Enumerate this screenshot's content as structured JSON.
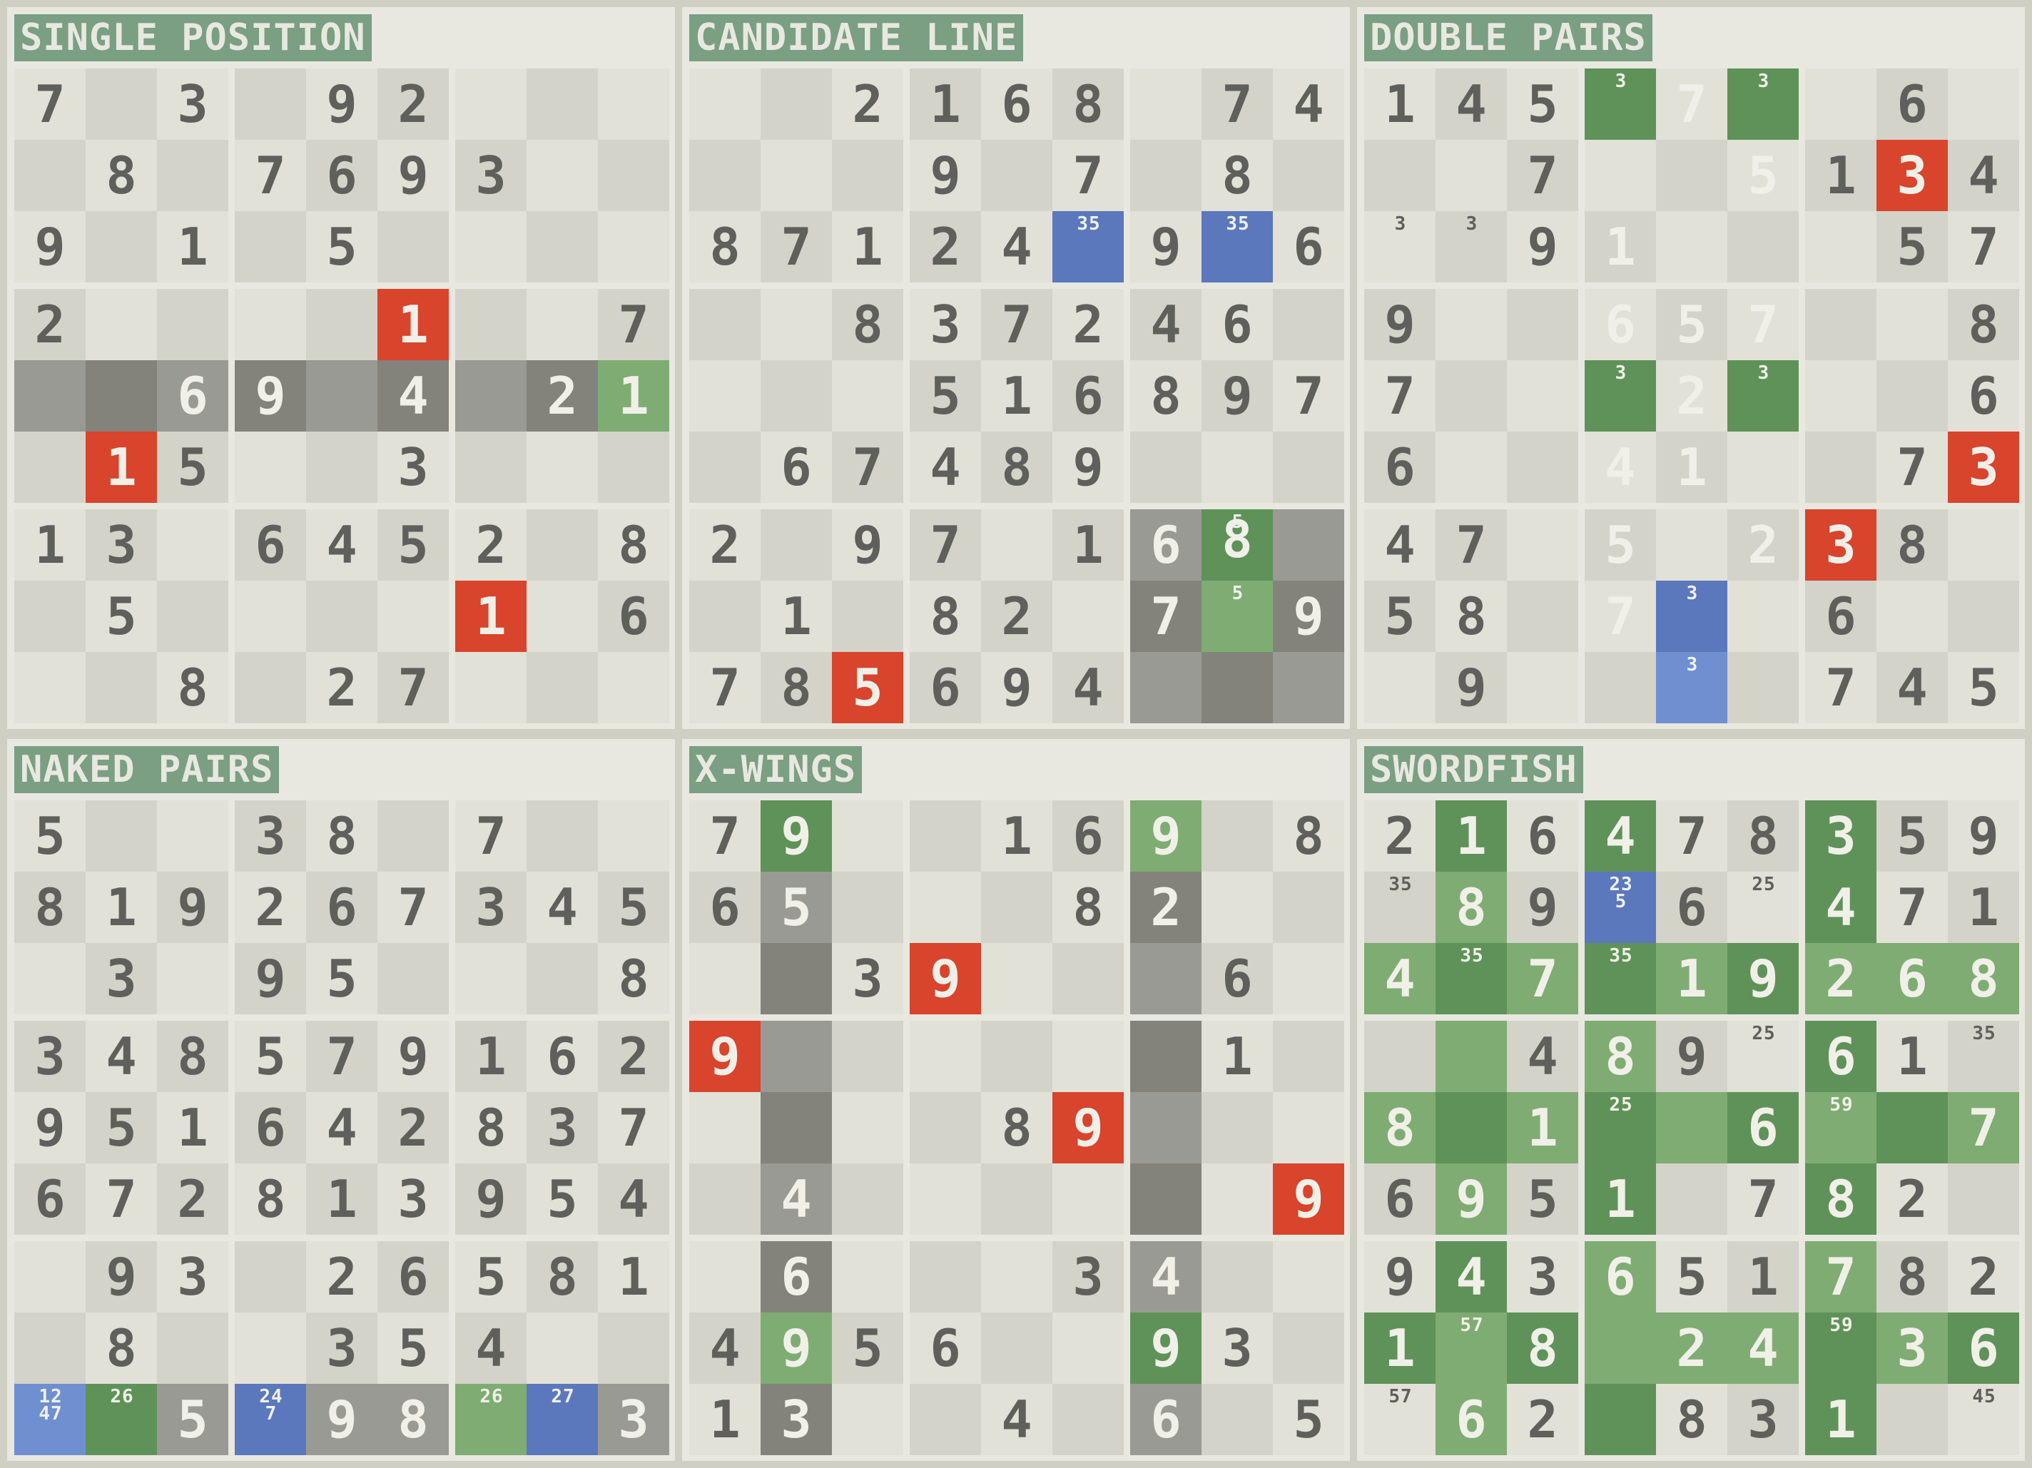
{
  "colors": {
    "background": "#cfcfc4",
    "panel": "#e8e8e0",
    "cell_light": "#e1e1d8",
    "cell_dark": "#d3d3c9",
    "digit": "#5f5f5c",
    "digit_light": "#f0f0e8",
    "red": "#d8442c",
    "green_dark": "#5f9259",
    "green_light": "#7fac72",
    "blue": "#5b78bd",
    "blue_light": "#6f8fd0",
    "gray": "#9a9a94",
    "gray_dark": "#83837c",
    "title_bg": "#7a9f82"
  },
  "panels": [
    {
      "title": "SINGLE POSITION",
      "grid": [
        "7.3.92...",
        ".8.7693..",
        "9.1.5....",
        "2....1..7",
        "..69.4.21",
        ".15..3...",
        "13.6452.8",
        ".5....1.6",
        "..8.27..."
      ],
      "cands": {},
      "styles": {
        "3,5": "red",
        "5,1": "red",
        "7,6": "red",
        "4,0": "gray",
        "4,1": "graydark",
        "4,2": "gray",
        "4,3": "graydark",
        "4,4": "gray",
        "4,5": "graydark",
        "4,6": "gray",
        "4,7": "graydark",
        "4,8": "greenlight"
      }
    },
    {
      "title": "CANDIDATE LINE",
      "grid": [
        "..2168.74",
        "...9.7.8.",
        "87124.9.6",
        "..837246.",
        "...516897",
        ".67489...",
        "2.97.168.",
        ".1.82.7.9",
        "785694..."
      ],
      "cands": {
        "2,5": "35",
        "2,7": "35",
        "6,7": "5",
        "7,7": "5"
      },
      "styles": {
        "2,5": "blue",
        "2,7": "blue",
        "8,2": "red",
        "6,6": "gray",
        "6,7": "greendark",
        "6,8": "gray",
        "7,6": "graydark",
        "7,7": "greenlight",
        "7,8": "graydark",
        "8,6": "gray",
        "8,7": "graydark",
        "8,8": "gray"
      }
    },
    {
      "title": "DOUBLE PAIRS",
      "grid": [
        "145.7..6.",
        "..7..5134",
        "..91...57",
        "9..657..8",
        "7...2...6",
        "6..41..73",
        "47.5.238.",
        "58.7..6..",
        ".9....745"
      ],
      "cands": {
        "0,3": "3",
        "0,5": "3",
        "2,0": "3",
        "2,1": "3",
        "4,3": "3",
        "4,5": "3",
        "7,4": "3",
        "8,4": "3"
      },
      "styles": {
        "0,3": "greendark",
        "0,5": "greendark",
        "4,3": "greendark",
        "4,5": "greendark",
        "1,7": "red",
        "5,8": "red",
        "6,6": "red",
        "7,4": "blue",
        "8,4": "bluelight",
        "0,4": "lightdigit",
        "1,5": "lightdigit",
        "2,3": "lightdigit",
        "3,3": "lightdigit",
        "3,4": "lightdigit",
        "3,5": "lightdigit",
        "4,4": "lightdigit",
        "5,3": "lightdigit",
        "5,4": "lightdigit",
        "6,3": "lightdigit",
        "6,5": "lightdigit",
        "7,3": "lightdigit"
      }
    },
    {
      "title": "NAKED PAIRS",
      "grid": [
        "5..38.7..",
        "819267345",
        ".3.95...8",
        "348579162",
        "951642837",
        "672813954",
        ".93.26581",
        ".8..354..",
        "..5.98..3"
      ],
      "cands": {
        "8,0": "12\n47",
        "8,1": "26",
        "8,3": "24\n7",
        "8,6": "26",
        "8,7": "27"
      },
      "styles": {
        "8,0": "bluelight",
        "8,1": "greendark",
        "8,2": "gray",
        "8,3": "blue",
        "8,4": "gray",
        "8,5": "gray",
        "8,6": "greenlight",
        "8,7": "blue",
        "8,8": "gray"
      }
    },
    {
      "title": "X-WINGS",
      "grid": [
        "79..169.8",
        "65...82..",
        "..39...6.",
        "9......1.",
        "....89...",
        ".4......9",
        ".6...34..",
        "4956..93.",
        "13..4.6.5"
      ],
      "cands": {},
      "styles": {
        "2,3": "red",
        "3,0": "red",
        "4,5": "red",
        "5,8": "red",
        "0,1": "greendark",
        "0,6": "greenlight",
        "7,1": "greenlight",
        "7,6": "greendark",
        "1,1": "gray",
        "2,1": "graydark",
        "3,1": "gray",
        "4,1": "graydark",
        "5,1": "gray",
        "6,1": "graydark",
        "8,1": "graydark",
        "1,6": "graydark",
        "2,6": "gray",
        "3,6": "graydark",
        "4,6": "gray",
        "5,6": "graydark",
        "6,6": "gray",
        "8,6": "gray"
      }
    },
    {
      "title": "SWORDFISH",
      "grid": [
        "216478359",
        ".89.6.471",
        "4.7.19268",
        "..489.61.",
        "8.1..6..7",
        "6951.782.",
        "943651782",
        "1.8.24.36",
        ".62.831.."
      ],
      "cands": {
        "1,0": "35",
        "1,3": "23\n5",
        "1,5": "25",
        "2,1": "35",
        "2,3": "35",
        "3,5": "25",
        "3,8": "35",
        "4,3": "25",
        "4,6": "59",
        "7,1": "57",
        "7,6": "59",
        "8,0": "57",
        "8,8": "45"
      },
      "styles": {
        "0,1": "greendark",
        "0,3": "greendark",
        "0,6": "greendark",
        "1,1": "greenlight",
        "1,3": "blue",
        "1,6": "greendark",
        "2,0": "greenlight",
        "2,1": "greendark",
        "2,2": "greenlight",
        "2,3": "greendark",
        "2,4": "greenlight",
        "2,5": "greendark",
        "2,6": "greenlight",
        "2,7": "greenlight",
        "2,8": "greenlight",
        "3,1": "greenlight",
        "3,3": "greenlight",
        "3,6": "greendark",
        "4,0": "greenlight",
        "4,1": "greendark",
        "4,2": "greenlight",
        "4,3": "greendark",
        "4,4": "greenlight",
        "4,5": "greendark",
        "4,6": "greenlight",
        "4,7": "greendark",
        "4,8": "greenlight",
        "5,1": "greenlight",
        "5,3": "greendark",
        "5,6": "greendark",
        "6,1": "greendark",
        "6,3": "greenlight",
        "6,6": "greenlight",
        "7,0": "greendark",
        "7,1": "greenlight",
        "7,2": "greendark",
        "7,3": "greenlight",
        "7,4": "greenlight",
        "7,5": "greenlight",
        "7,6": "greendark",
        "7,7": "greenlight",
        "7,8": "greendark",
        "8,1": "greenlight",
        "8,3": "greendark",
        "8,6": "greendark",
        "1,4": "plain"
      }
    }
  ]
}
